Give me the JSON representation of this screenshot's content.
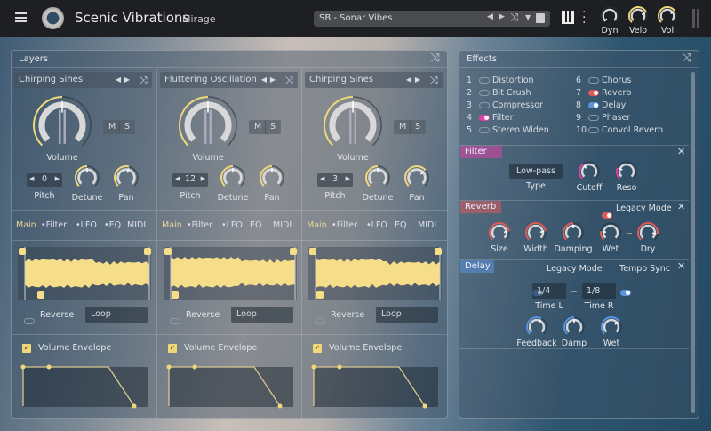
{
  "header": {
    "title": "Scenic Vibrations",
    "subtitle": "Mirage",
    "preset": "SB - Sonar Vibes",
    "knobs": [
      {
        "label": "Dyn",
        "value": 0.0
      },
      {
        "label": "Velo",
        "value": 0.75
      },
      {
        "label": "Vol",
        "value": 0.7
      }
    ]
  },
  "layers": {
    "title": "Layers",
    "columns": [
      {
        "name": "Chirping Sines",
        "volume_label": "Volume",
        "volume": 0.5,
        "mute": "M",
        "solo": "S",
        "pitch": "0",
        "pitch_label": "Pitch",
        "detune_label": "Detune",
        "detune": 0.5,
        "pan_label": "Pan",
        "pan": 0.55,
        "tabs": [
          "Main",
          "•Filter",
          "•LFO",
          "•EQ",
          "MIDI"
        ],
        "reverse": "Reverse",
        "loop": "Loop",
        "envelope": "Volume Envelope"
      },
      {
        "name": "Fluttering Oscillation",
        "volume_label": "Volume",
        "volume": 0.5,
        "mute": "M",
        "solo": "S",
        "pitch": "12",
        "pitch_label": "Pitch",
        "detune_label": "Detune",
        "detune": 0.5,
        "pan_label": "Pan",
        "pan": 0.5,
        "tabs": [
          "Main",
          "•Filter",
          "•LFO",
          "EQ",
          "MIDI"
        ],
        "reverse": "Reverse",
        "loop": "Loop",
        "envelope": "Volume Envelope"
      },
      {
        "name": "Chirping Sines",
        "volume_label": "Volume",
        "volume": 0.5,
        "mute": "M",
        "solo": "S",
        "pitch": "3",
        "pitch_label": "Pitch",
        "detune_label": "Detune",
        "detune": 0.5,
        "pan_label": "Pan",
        "pan": 0.68,
        "tabs": [
          "Main",
          "•Filter",
          "•LFO",
          "EQ",
          "MIDI"
        ],
        "reverse": "Reverse",
        "loop": "Loop",
        "envelope": "Volume Envelope"
      }
    ]
  },
  "effects": {
    "title": "Effects",
    "list": [
      {
        "n": "1",
        "name": "Distortion",
        "on": false,
        "color": ""
      },
      {
        "n": "2",
        "name": "Bit Crush",
        "on": false,
        "color": ""
      },
      {
        "n": "3",
        "name": "Compressor",
        "on": false,
        "color": ""
      },
      {
        "n": "4",
        "name": "Filter",
        "on": true,
        "color": "#e040a8"
      },
      {
        "n": "5",
        "name": "Stereo Widen",
        "on": false,
        "color": ""
      },
      {
        "n": "6",
        "name": "Chorus",
        "on": false,
        "color": ""
      },
      {
        "n": "7",
        "name": "Reverb",
        "on": true,
        "color": "#e05a5a"
      },
      {
        "n": "8",
        "name": "Delay",
        "on": true,
        "color": "#5a94e0"
      },
      {
        "n": "9",
        "name": "Phaser",
        "on": false,
        "color": ""
      },
      {
        "n": "10",
        "name": "Convol Reverb",
        "on": false,
        "color": ""
      }
    ],
    "filter": {
      "title": "Filter",
      "color": "#e040a8",
      "type_value": "Low-pass",
      "type_label": "Type",
      "knobs": [
        {
          "label": "Cutoff",
          "value": 0.35
        },
        {
          "label": "Reso",
          "value": 0.25
        }
      ]
    },
    "reverb": {
      "title": "Reverb",
      "color": "#e05a5a",
      "legacy": "Legacy Mode",
      "knobs": [
        {
          "label": "Size",
          "value": 0.8
        },
        {
          "label": "Width",
          "value": 0.8
        },
        {
          "label": "Damping",
          "value": 0.5
        },
        {
          "label": "Wet",
          "value": 0.2
        },
        {
          "label": "Dry",
          "value": 0.85
        }
      ]
    },
    "delay": {
      "title": "Delay",
      "color": "#5a94e0",
      "legacy": "Legacy Mode",
      "tempo_sync": "Tempo Sync",
      "time_l": "1/4",
      "time_l_label": "Time L",
      "time_r": "1/8",
      "time_r_label": "Time R",
      "knobs": [
        {
          "label": "Feedback",
          "value": 0.6
        },
        {
          "label": "Damp",
          "value": 0.5
        },
        {
          "label": "Wet",
          "value": 0.7
        }
      ]
    }
  },
  "colors": {
    "accent": "#f0d878",
    "topbar": "#1e1f22"
  }
}
